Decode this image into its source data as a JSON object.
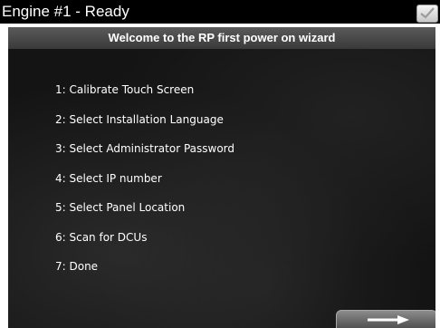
{
  "title_bar": {
    "title": "Engine #1 - Ready",
    "status_icon": "checkmark-icon"
  },
  "wizard": {
    "heading": "Welcome to the RP first power on wizard",
    "items": [
      {
        "label": "1: Calibrate Touch Screen"
      },
      {
        "label": "2: Select Installation Language"
      },
      {
        "label": "3: Select Administrator Password"
      },
      {
        "label": "4: Select IP number"
      },
      {
        "label": "5: Select Panel Location"
      },
      {
        "label": "6: Scan for DCUs"
      },
      {
        "label": "7: Done"
      }
    ],
    "next_icon": "right-arrow-icon"
  },
  "colors": {
    "title_bar_bg": "#000000",
    "panel_bg": "#141414",
    "header_bg": "#4a4a4a",
    "text": "#ffffff"
  }
}
